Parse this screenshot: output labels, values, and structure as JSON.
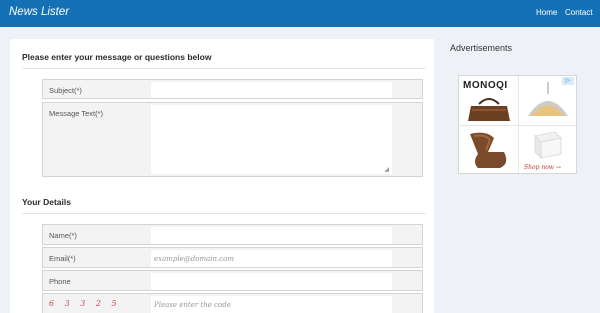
{
  "navbar": {
    "brand": "News Lister",
    "links": [
      "Home",
      "Contact"
    ],
    "color": "#1471b5"
  },
  "message_section": {
    "title": "Please enter your message or questions below",
    "fields": [
      {
        "label": "Subject(*)",
        "value": "",
        "placeholder": ""
      },
      {
        "label": "Message Text(*)",
        "value": "",
        "placeholder": ""
      }
    ]
  },
  "details_section": {
    "title": "Your Details",
    "fields": [
      {
        "label": "Name(*)",
        "value": "",
        "placeholder": ""
      },
      {
        "label": "Email(*)",
        "value": "",
        "placeholder": "example@domain.com"
      },
      {
        "label": "Phone",
        "value": "",
        "placeholder": ""
      }
    ],
    "captcha": {
      "code": "6 3 3 2 5",
      "placeholder": "Please enter the code"
    }
  },
  "sidebar": {
    "ads_title": "Advertisements",
    "ad": {
      "brand": "MONOQI",
      "cta": "Shop now →",
      "choice_icon": "adchoices-icon"
    }
  }
}
